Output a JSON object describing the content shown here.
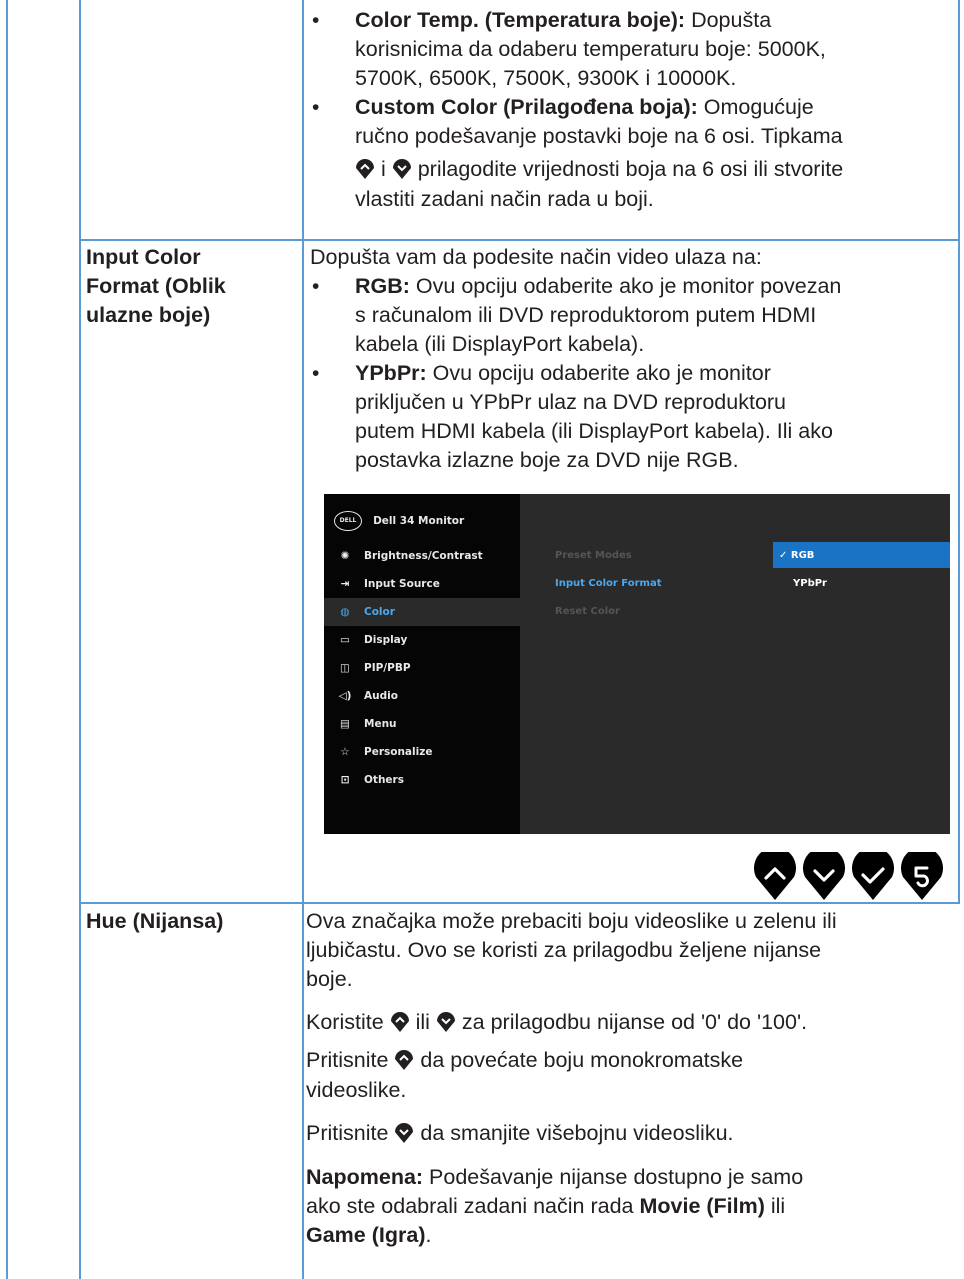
{
  "top_row": {
    "bullets": [
      {
        "term": "Color Temp. (Temperatura boje):",
        "lines": [
          " Dopušta",
          "korisnicima da odaberu temperaturu boje: 5000K,",
          "5700K, 6500K, 7500K, 9300K i 10000K."
        ]
      },
      {
        "term": "Custom Color (Prilagođena boja):",
        "lines": [
          " Omogućuje",
          "ručno podešavanje postavki boje na 6 osi. Tipkama"
        ]
      }
    ],
    "custom_line3_a": " i ",
    "custom_line3_b": " prilagodite vrijednosti boja na 6 osi ili stvorite",
    "custom_line4": "vlastiti zadani način rada u boji."
  },
  "input_color_row": {
    "label_lines": [
      "Input Color",
      "Format (Oblik",
      "ulazne boje)"
    ],
    "intro": "Dopušta vam da podesite način video ulaza na:",
    "rgb_term": "RGB:",
    "rgb_lines": [
      " Ovu opciju odaberite ako je monitor povezan",
      "s računalom ili DVD reproduktorom putem HDMI",
      "kabela (ili DisplayPort kabela)."
    ],
    "ypbpr_term": "YPbPr:",
    "ypbpr_lines": [
      " Ovu opciju odaberite ako je monitor",
      "priključen u YPbPr ulaz na DVD reproduktoru",
      "putem HDMI kabela (ili DisplayPort kabela). Ili ako",
      "postavka izlazne boje za DVD nije RGB."
    ]
  },
  "osd": {
    "logo": "DELL",
    "title": "Dell 34 Monitor",
    "menu": [
      "Brightness/Contrast",
      "Input Source",
      "Color",
      "Display",
      "PIP/PBP",
      "Audio",
      "Menu",
      "Personalize",
      "Others"
    ],
    "submenu": [
      "Preset Modes",
      "Input Color Format",
      "Reset Color"
    ],
    "options": [
      "RGB",
      "YPbPr"
    ],
    "check": "✓",
    "colors": {
      "active": "#4aa8f0",
      "highlight": "#1a73c4",
      "panel": "#2a2a2a",
      "left": "#050505"
    }
  },
  "buttons": [
    "up-button",
    "down-button",
    "confirm-button",
    "back-button"
  ],
  "hue_row": {
    "label": "Hue (Nijansa)",
    "p1": [
      "Ova značajka može prebaciti boju videoslike u zelenu ili",
      "ljubičastu. Ovo se koristi za prilagodbu željene nijanse",
      "boje."
    ],
    "p2_a": "Koristite ",
    "p2_b": " ili ",
    "p2_c": " za prilagodbu nijanse od '0' do '100'.",
    "p3_a": "Pritisnite ",
    "p3_b": " da povećate boju monokromatske",
    "p3_c": "videoslike.",
    "p4_a": "Pritisnite ",
    "p4_b": " da smanjite višebojnu videosliku.",
    "note_term": "Napomena:",
    "note_line1": " Podešavanje nijanse dostupno je samo",
    "note_line2_a": "ako ste odabrali zadani način rada ",
    "note_line2_b": "Movie (Film)",
    "note_line2_c": " ili",
    "note_line3_a": "Game (Igra)",
    "note_line3_b": "."
  }
}
